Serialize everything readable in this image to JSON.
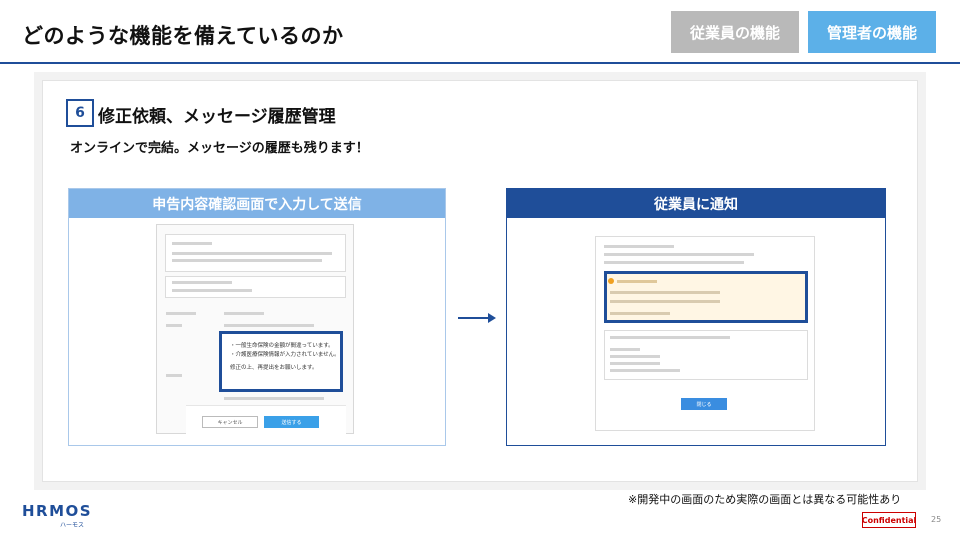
{
  "header": {
    "title": "どのような機能を備えているのか",
    "tab_employee": "従業員の機能",
    "tab_admin": "管理者の機能"
  },
  "section": {
    "number": "6",
    "title": "修正依頼、メッセージ履歴管理",
    "subtitle": "オンラインで完結。メッセージの履歴も残ります！"
  },
  "left_panel": {
    "header": "申告内容確認画面で入力して送信",
    "message_lines": [
      "・一般生命保険の金額が間違っています。",
      "・介護医療保険情報が入力されていません。",
      "修正の上、再提出をお願いします。"
    ],
    "cancel_label": "キャンセル",
    "send_label": "送信する"
  },
  "right_panel": {
    "header": "従業員に通知",
    "close_label": "閉じる"
  },
  "footer": {
    "note": "※開発中の画面のため実際の画面とは異なる可能性あり",
    "logo": "HRMOS",
    "logo_sub": "ハーモス",
    "confidential": "Confidential",
    "page": "25"
  },
  "colors": {
    "primary": "#1f4e99",
    "tab_active": "#5cb0e8",
    "tab_inactive": "#b9b9b9",
    "confidential": "#cc0000"
  }
}
